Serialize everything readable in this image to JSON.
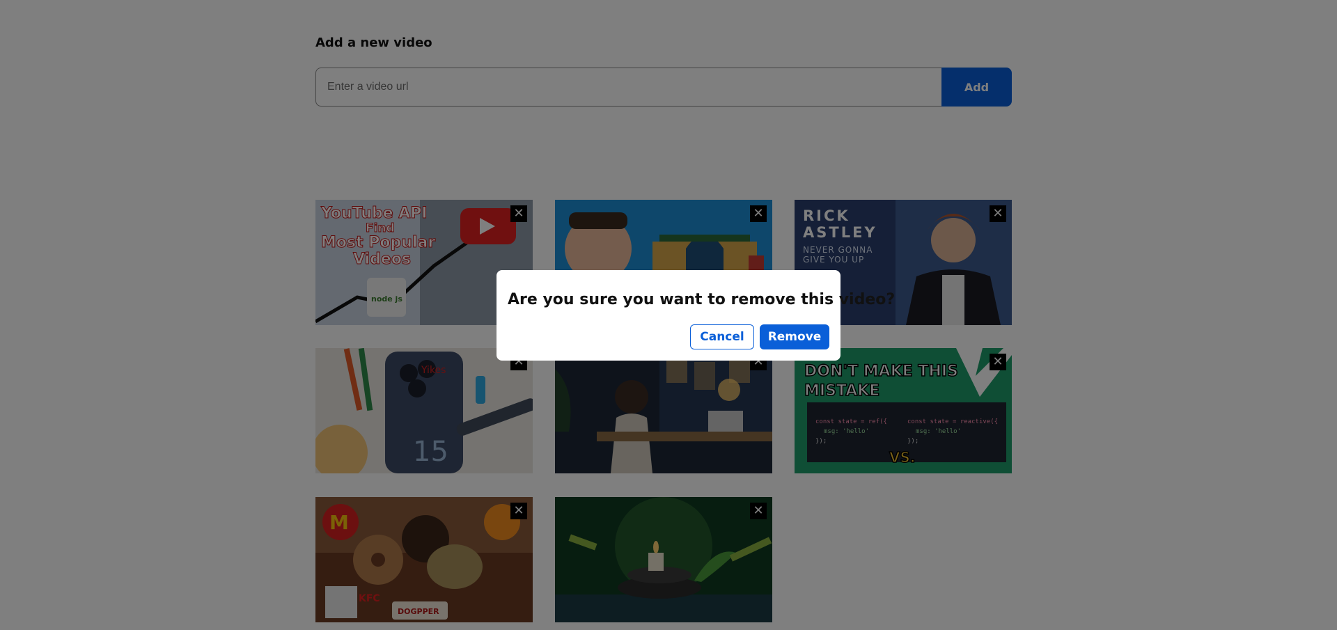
{
  "form": {
    "title": "Add a new video",
    "placeholder": "Enter a video url",
    "add_label": "Add"
  },
  "close_symbol": "✕",
  "videos": [
    {
      "name": "video-youtube-api",
      "lines": [
        "YouTube API",
        "Find",
        "Most Popular",
        "Videos"
      ],
      "badge": "node js",
      "bg": "#b8c6d8"
    },
    {
      "name": "video-mrbeast-mansion",
      "lines": [],
      "bg": "#1c8fd6"
    },
    {
      "name": "video-rick-astley",
      "lines": [
        "RICK",
        "ASTLEY",
        "NEVER GONNA",
        "GIVE YOU UP"
      ],
      "bg": "#2b3f6e"
    },
    {
      "name": "video-iphone-15",
      "lines": [
        "Yikes",
        "15"
      ],
      "bg": "#e9e6e2"
    },
    {
      "name": "video-lofi-study",
      "lines": [],
      "bg": "#1d2636"
    },
    {
      "name": "video-vue-ref-reactive",
      "lines": [
        "DON'T MAKE THIS",
        "MISTAKE",
        "const state = ref({",
        "msg: 'hello'",
        "});",
        "const state = reactive({",
        "msg: 'hello'",
        "});",
        "VS."
      ],
      "bg": "#1e9c6b"
    },
    {
      "name": "video-fast-food",
      "lines": [
        "KFC",
        "DOGPPER"
      ],
      "bg": "#6b3a22"
    },
    {
      "name": "video-zen-candle",
      "lines": [],
      "bg": "#0f3a20"
    }
  ],
  "dialog": {
    "message": "Are you sure you want to remove this video?",
    "cancel_label": "Cancel",
    "remove_label": "Remove"
  },
  "colors": {
    "accent": "#0a5fd8",
    "overlay": "rgba(0,0,0,0.5)"
  }
}
